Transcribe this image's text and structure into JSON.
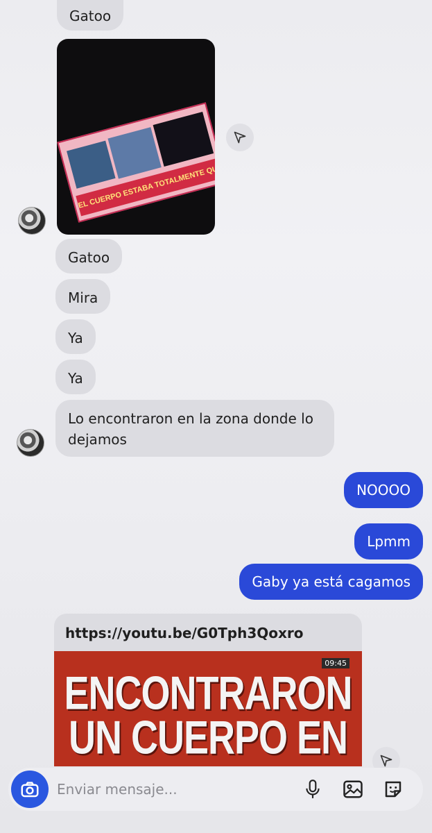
{
  "thread": {
    "incoming": {
      "top_partial": "Gatoo",
      "messages": [
        "Gatoo",
        "Mira",
        "Ya",
        "Ya"
      ],
      "long_message": "Lo encontraron en la zona donde lo dejamos"
    },
    "photo": {
      "banner_text": "EL CUERPO ESTABA TOTALMENTE QUEMADO"
    },
    "outgoing": [
      "NOOOO",
      "Lpmm",
      "Gaby ya está cagamos"
    ],
    "link_preview": {
      "url": "https://youtu.be/G0Tph3Qoxro",
      "headline_line1": "ENCONTRARON",
      "headline_line2": "UN CUERPO EN",
      "timestamp": "09:45"
    }
  },
  "composer": {
    "placeholder": "Enviar mensaje..."
  },
  "colors": {
    "outgoing_bubble": "#2a49d8",
    "incoming_bubble": "#dcdce1",
    "camera_button": "#2a57e0"
  },
  "icons": [
    "send-share-icon",
    "camera-icon",
    "microphone-icon",
    "gallery-icon",
    "sticker-icon"
  ]
}
